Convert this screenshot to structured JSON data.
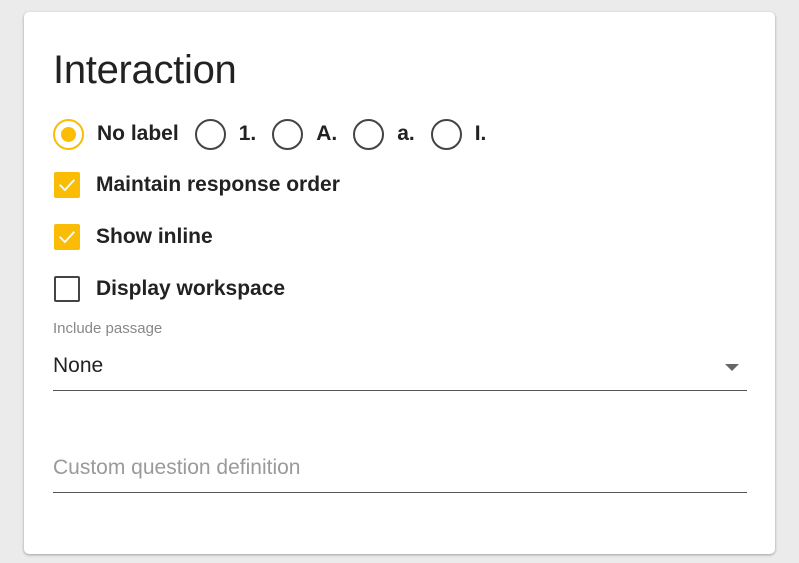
{
  "panel": {
    "title": "Interaction"
  },
  "label_style": {
    "selected": "No label",
    "options": [
      {
        "label": "No label",
        "checked": true
      },
      {
        "label": "1.",
        "checked": false
      },
      {
        "label": "A.",
        "checked": false
      },
      {
        "label": "a.",
        "checked": false
      },
      {
        "label": "I.",
        "checked": false
      }
    ]
  },
  "checkboxes": [
    {
      "label": "Maintain response order",
      "checked": true
    },
    {
      "label": "Show inline",
      "checked": true
    },
    {
      "label": "Display workspace",
      "checked": false
    }
  ],
  "include_passage": {
    "label": "Include passage",
    "value": "None"
  },
  "custom_question": {
    "placeholder": "Custom question definition",
    "value": ""
  },
  "colors": {
    "accent": "#fbbc05",
    "text": "#222222",
    "muted": "#888888",
    "background": "#ebebeb",
    "card": "#ffffff"
  }
}
